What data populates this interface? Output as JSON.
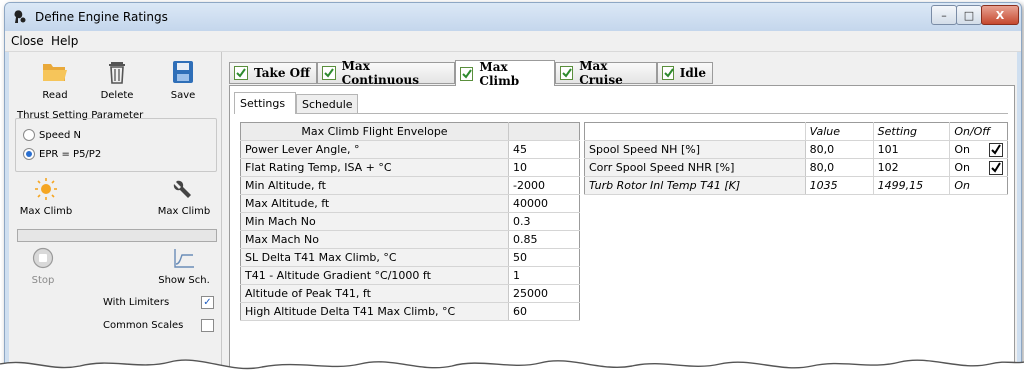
{
  "window": {
    "title": "Define Engine Ratings",
    "controls": {
      "minimize": "–",
      "maximize": "□",
      "close": "X"
    }
  },
  "menu": {
    "items": [
      "Close",
      "Help"
    ]
  },
  "toolbar": {
    "read_label": "Read",
    "delete_label": "Delete",
    "save_label": "Save"
  },
  "thrust_setting": {
    "title": "Thrust Setting Parameter",
    "options": [
      "Speed N",
      "EPR = P5/P2"
    ],
    "selected": "EPR = P5/P2"
  },
  "actions": {
    "max_climb_left": "Max Climb",
    "max_climb_right": "Max Climb",
    "stop": "Stop",
    "show_sch": "Show Sch."
  },
  "progress": {
    "value": 0
  },
  "options": {
    "with_limiters": {
      "label": "With Limiters",
      "checked": true
    },
    "common_scales": {
      "label": "Common Scales",
      "checked": false
    }
  },
  "rating_tabs": [
    {
      "label": "Take Off",
      "checked": true
    },
    {
      "label": "Max Continuous",
      "checked": true
    },
    {
      "label": "Max Climb",
      "checked": true,
      "active": true
    },
    {
      "label": "Max Cruise",
      "checked": true
    },
    {
      "label": "Idle",
      "checked": true
    }
  ],
  "sub_tabs": [
    "Settings",
    "Schedule"
  ],
  "envelope": {
    "header": "Max Climb Flight Envelope",
    "rows": [
      {
        "name": "Power Lever Angle, °",
        "value": "45"
      },
      {
        "name": "Flat Rating Temp, ISA + °C",
        "value": "10"
      },
      {
        "name": "Min Altitude, ft",
        "value": "-2000"
      },
      {
        "name": "Max Altitude, ft",
        "value": "40000"
      },
      {
        "name": "Min Mach No",
        "value": "0.3"
      },
      {
        "name": "Max Mach No",
        "value": "0.85"
      },
      {
        "name": "SL Delta T41 Max Climb, °C",
        "value": "50"
      },
      {
        "name": "T41 - Altitude Gradient °C/1000 ft",
        "value": "1"
      },
      {
        "name": "Altitude of Peak T41, ft",
        "value": "25000"
      },
      {
        "name": "High Altitude Delta T41 Max Climb, °C",
        "value": "60"
      }
    ]
  },
  "spool": {
    "headers": [
      "",
      "Value",
      "Setting",
      "On/Off"
    ],
    "rows": [
      {
        "name": "Spool Speed NH [%]",
        "value": "80,0",
        "setting": "101",
        "onoff": "On",
        "checked": true
      },
      {
        "name": "Corr Spool Speed NHR [%]",
        "value": "80,0",
        "setting": "102",
        "onoff": "On",
        "checked": true
      },
      {
        "name": "Turb Rotor Inl Temp T41 [K]",
        "value": "1035",
        "setting": "1499,15",
        "onoff": "On",
        "checked": false
      }
    ]
  },
  "colors": {
    "accent": "#2a6fd0",
    "check_green": "#2e8b2e",
    "tab_border": "#9b9b9b"
  }
}
